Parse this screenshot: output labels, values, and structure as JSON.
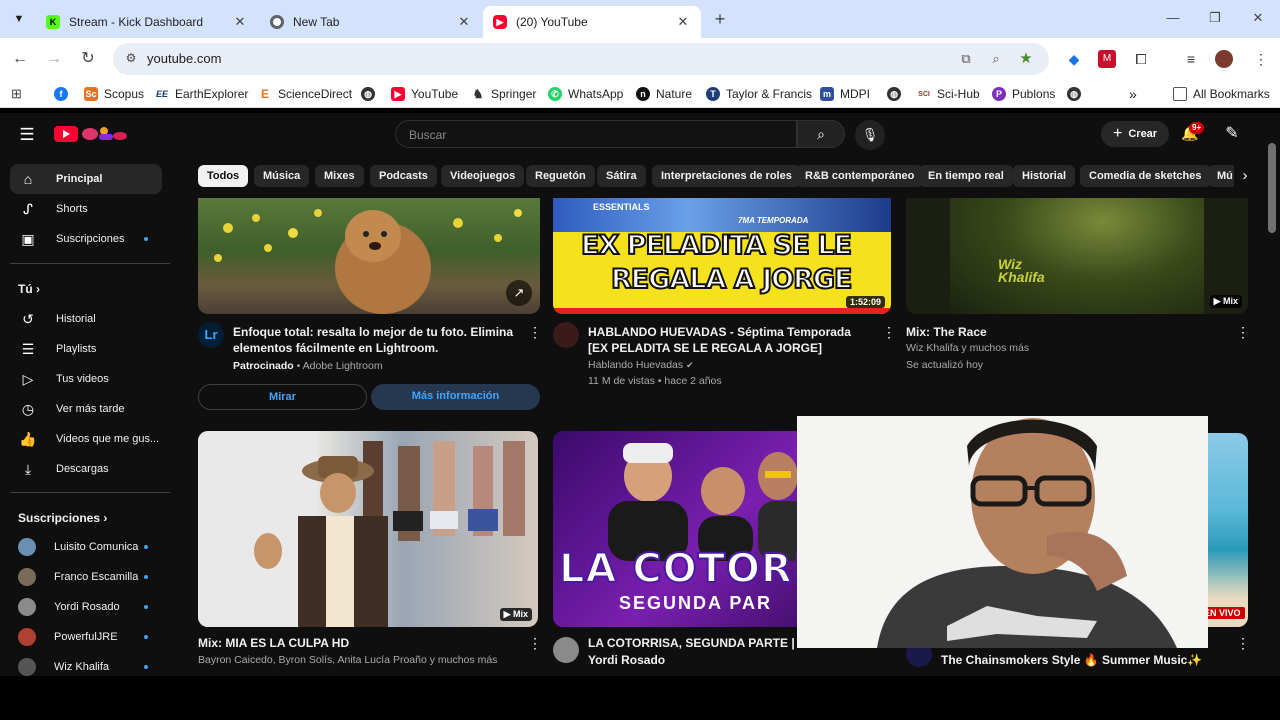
{
  "browser": {
    "tabs": [
      {
        "title": "Stream - Kick Dashboard",
        "favicon": "kick-icon",
        "color": "#53fc18"
      },
      {
        "title": "New Tab",
        "favicon": "chrome-icon",
        "color": "#5f6368"
      },
      {
        "title": "(20) YouTube",
        "favicon": "youtube-icon",
        "color": "#ff0033"
      }
    ],
    "url": "youtube.com",
    "bookmarks": [
      {
        "label": "",
        "icon": "facebook-icon",
        "color": "#1877f2"
      },
      {
        "label": "Scopus",
        "icon": "scopus-icon",
        "color": "#e9711c"
      },
      {
        "label": "EarthExplorer",
        "icon": "ee-icon",
        "color": "#1a3e6f"
      },
      {
        "label": "ScienceDirect",
        "icon": "elsevier-icon",
        "color": "#e9711c"
      },
      {
        "label": "",
        "icon": "globe-icon",
        "color": "#333333"
      },
      {
        "label": "YouTube",
        "icon": "youtube-icon",
        "color": "#ff0033"
      },
      {
        "label": "Springer",
        "icon": "springer-icon",
        "color": "#333333"
      },
      {
        "label": "WhatsApp",
        "icon": "whatsapp-icon",
        "color": "#25d366"
      },
      {
        "label": "Nature",
        "icon": "nature-icon",
        "color": "#111111"
      },
      {
        "label": "Taylor & Francis",
        "icon": "tf-icon",
        "color": "#1d3c78"
      },
      {
        "label": "MDPI",
        "icon": "mdpi-icon",
        "color": "#2f4f9f"
      },
      {
        "label": "",
        "icon": "globe-icon",
        "color": "#333333"
      },
      {
        "label": "Sci-Hub",
        "icon": "scihub-icon",
        "color": "#b22222"
      },
      {
        "label": "Publons",
        "icon": "publons-icon",
        "color": "#7a2fbf"
      },
      {
        "label": "",
        "icon": "globe-icon",
        "color": "#333333"
      }
    ],
    "all_bookmarks": "All Bookmarks"
  },
  "youtube": {
    "search_placeholder": "Buscar",
    "create_label": "Crear",
    "notif_count": "9+",
    "sidebar": {
      "main": [
        {
          "label": "Principal",
          "icon": "home-icon"
        },
        {
          "label": "Shorts",
          "icon": "shorts-icon"
        },
        {
          "label": "Suscripciones",
          "icon": "subscriptions-icon"
        }
      ],
      "you_heading": "Tú",
      "you": [
        {
          "label": "Historial",
          "icon": "history-icon"
        },
        {
          "label": "Playlists",
          "icon": "playlists-icon"
        },
        {
          "label": "Tus videos",
          "icon": "your-videos-icon"
        },
        {
          "label": "Ver más tarde",
          "icon": "watch-later-icon"
        },
        {
          "label": "Videos que me gus...",
          "icon": "like-icon"
        },
        {
          "label": "Descargas",
          "icon": "download-icon"
        }
      ],
      "subs_heading": "Suscripciones",
      "subs": [
        {
          "label": "Luisito Comunica",
          "color": "#6a8fb3"
        },
        {
          "label": "Franco Escamilla",
          "color": "#7a6a5a"
        },
        {
          "label": "Yordi Rosado",
          "color": "#8a8a8a"
        },
        {
          "label": "PowerfulJRE",
          "color": "#b04030"
        },
        {
          "label": "Wiz Khalifa",
          "color": "#555555"
        }
      ]
    },
    "chips": [
      "Todos",
      "Música",
      "Mixes",
      "Podcasts",
      "Videojuegos",
      "Reguetón",
      "Sátira",
      "Interpretaciones de roles",
      "R&B contemporáneo",
      "En tiempo real",
      "Historial",
      "Comedia de sketches",
      "Mú"
    ],
    "videos": [
      {
        "title": "Enfoque total: resalta lo mejor de tu foto. Elimina elementos fácilmente en Lightroom.",
        "sponsored": "Patrocinado",
        "channel": "Adobe Lightroom",
        "channel_badge": "Lr",
        "btn_watch": "Mirar",
        "btn_more": "Más información"
      },
      {
        "title": "HABLANDO HUEVADAS - Séptima Temporada [EX PELADITA SE LE REGALA A JORGE]",
        "channel": "Hablando Huevadas",
        "stats": "11 M de vistas • hace 2 años",
        "duration": "1:52:09",
        "thumb_text_1": "EX PELADITA SE LE",
        "thumb_text_2": "REGALA A JORGE",
        "thumb_tag": "7MA TEMPORADA",
        "thumb_tag2": "ESSENTIALS"
      },
      {
        "title": "Mix: The Race",
        "channel": "Wiz Khalifa y muchos más",
        "stats": "Se actualizó hoy",
        "badge": "Mix",
        "thumb_text": "Wiz Khalifa"
      },
      {
        "title": "Mix: MIA ES LA CULPA  HD",
        "channel": "Bayron Caicedo, Byron Solís, Anita Lucía Proaño y muchos más",
        "badge": "Mix"
      },
      {
        "title": "LA COTORRISA, SEGUNDA PARTE | La e",
        "title2": "Yordi Rosado",
        "thumb_text_1": "LA COTORR",
        "thumb_text_2": "SEGUNDA PAR"
      },
      {
        "title": "The Chainsmokers Style 🔥 Summer Music✨",
        "badge": "EN VIVO"
      }
    ]
  }
}
